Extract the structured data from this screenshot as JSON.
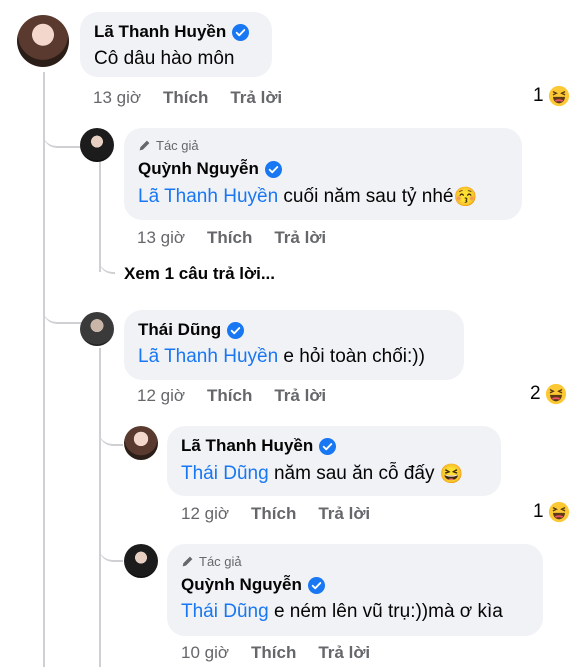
{
  "comments": [
    {
      "author": "Lã Thanh Huyền",
      "text": "Cô dâu hào môn",
      "time": "13 giờ",
      "like": "Thích",
      "reply": "Trả lời",
      "reaction_count": "1"
    },
    {
      "tag": "Tác giả",
      "author": "Quỳnh Nguyễn",
      "mention": "Lã Thanh Huyền",
      "text": " cuối năm sau tỷ nhé",
      "emoji": "😚",
      "time": "13 giờ",
      "like": "Thích",
      "reply": "Trả lời"
    },
    {
      "author": "Thái Dũng",
      "mention": "Lã Thanh Huyền",
      "text": " e hỏi toàn chối:))",
      "time": "12 giờ",
      "like": "Thích",
      "reply": "Trả lời",
      "reaction_count": "2"
    },
    {
      "author": "Lã Thanh Huyền",
      "mention": "Thái Dũng",
      "text": " năm sau ăn cỗ đấy",
      "emoji": "😆",
      "time": "12 giờ",
      "like": "Thích",
      "reply": "Trả lời",
      "reaction_count": "1"
    },
    {
      "tag": "Tác giả",
      "author": "Quỳnh Nguyễn",
      "mention": "Thái Dũng",
      "text": " e ném lên vũ trụ:))mà ơ kìa",
      "time": "10 giờ",
      "like": "Thích",
      "reply": "Trả lời"
    }
  ],
  "view_more": "Xem 1 câu trả lời...",
  "icons": {
    "verified": "verified-badge-icon",
    "reaction": "haha-reaction-icon",
    "author_tag": "pen-icon"
  },
  "colors": {
    "mention": "#1877f2",
    "verified": "#1877f2",
    "bubble": "#f0f2f5",
    "meta": "#65676b"
  }
}
